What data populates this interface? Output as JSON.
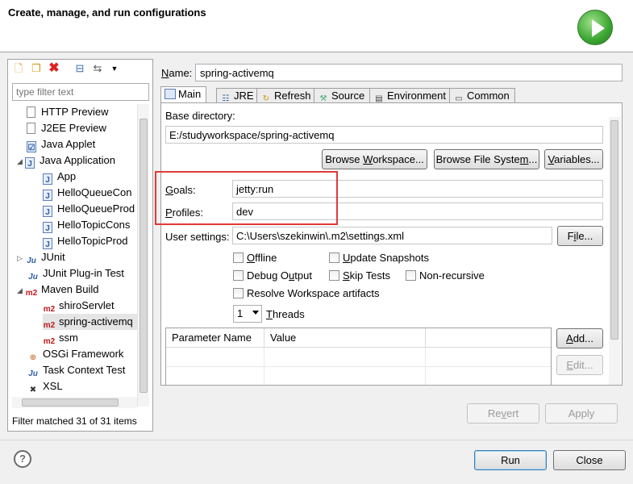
{
  "header": {
    "title": "Create, manage, and run configurations"
  },
  "toolbar": {
    "icons": [
      "new-configuration-icon",
      "duplicate-icon",
      "delete-icon",
      "collapse-all-icon",
      "filter-icon",
      "view-menu-icon"
    ]
  },
  "filter": {
    "placeholder": "type filter text",
    "status": "Filter matched 31 of 31 items"
  },
  "tree": {
    "items": [
      {
        "label": "HTTP Preview"
      },
      {
        "label": "J2EE Preview"
      },
      {
        "label": "Java Applet"
      },
      {
        "label": "Java Application"
      },
      {
        "label": "App"
      },
      {
        "label": "HelloQueueCon"
      },
      {
        "label": "HelloQueueProd"
      },
      {
        "label": "HelloTopicCons"
      },
      {
        "label": "HelloTopicProd"
      },
      {
        "label": "JUnit"
      },
      {
        "label": "JUnit Plug-in Test"
      },
      {
        "label": "Maven Build"
      },
      {
        "label": "shiroServlet"
      },
      {
        "label": "spring-activemq"
      },
      {
        "label": "ssm"
      },
      {
        "label": "OSGi Framework"
      },
      {
        "label": "Task Context Test"
      },
      {
        "label": "XSL"
      }
    ]
  },
  "config": {
    "name_label": "Name:",
    "name_value": "spring-activemq",
    "tabs": [
      "Main",
      "JRE",
      "Refresh",
      "Source",
      "Environment",
      "Common"
    ],
    "base_dir_label": "Base directory:",
    "base_dir_value": "E:/studyworkspace/spring-activemq",
    "browse_workspace": "Browse Workspace...",
    "browse_fs": "Browse File System...",
    "variables": "Variables...",
    "goals_label": "Goals:",
    "goals_value": "jetty:run",
    "profiles_label": "Profiles:",
    "profiles_value": "dev",
    "user_settings_label": "User settings:",
    "user_settings_value": "C:\\Users\\szekinwin\\.m2\\settings.xml",
    "file_button": "File...",
    "checkboxes": {
      "offline": "Offline",
      "update_snapshots": "Update Snapshots",
      "debug_output": "Debug Output",
      "skip_tests": "Skip Tests",
      "non_recursive": "Non-recursive",
      "resolve_workspace": "Resolve Workspace artifacts"
    },
    "threads_value": "1",
    "threads_label": "Threads",
    "param_headers": [
      "Parameter Name",
      "Value"
    ],
    "add": "Add...",
    "edit": "Edit..."
  },
  "actions": {
    "revert": "Revert",
    "apply": "Apply",
    "run": "Run",
    "close": "Close",
    "help": "?"
  }
}
